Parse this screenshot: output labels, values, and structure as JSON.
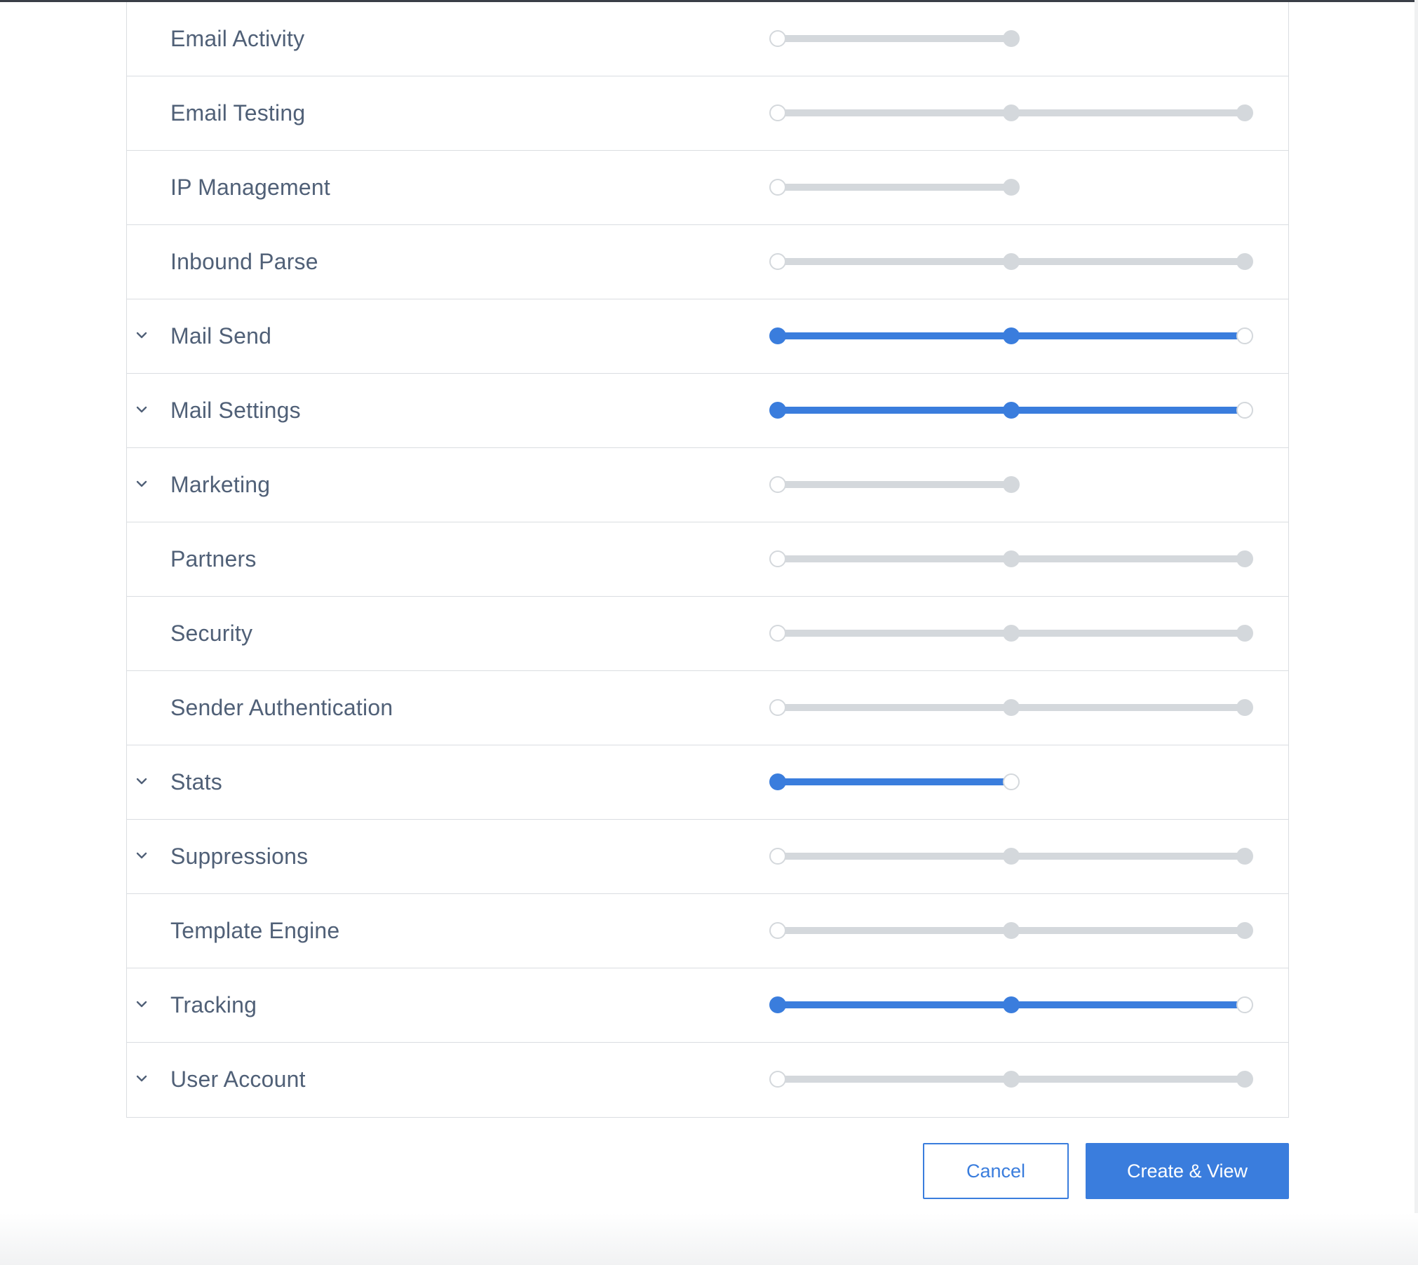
{
  "scopes": [
    {
      "label": "Email Activity",
      "expandable": false,
      "levels": 2,
      "selected": 0
    },
    {
      "label": "Email Testing",
      "expandable": false,
      "levels": 3,
      "selected": 0
    },
    {
      "label": "IP Management",
      "expandable": false,
      "levels": 2,
      "selected": 0
    },
    {
      "label": "Inbound Parse",
      "expandable": false,
      "levels": 3,
      "selected": 0
    },
    {
      "label": "Mail Send",
      "expandable": true,
      "levels": 3,
      "selected": 2
    },
    {
      "label": "Mail Settings",
      "expandable": true,
      "levels": 3,
      "selected": 2
    },
    {
      "label": "Marketing",
      "expandable": true,
      "levels": 2,
      "selected": 0
    },
    {
      "label": "Partners",
      "expandable": false,
      "levels": 3,
      "selected": 0
    },
    {
      "label": "Security",
      "expandable": false,
      "levels": 3,
      "selected": 0
    },
    {
      "label": "Sender Authentication",
      "expandable": false,
      "levels": 3,
      "selected": 0
    },
    {
      "label": "Stats",
      "expandable": true,
      "levels": 2,
      "selected": 1
    },
    {
      "label": "Suppressions",
      "expandable": true,
      "levels": 3,
      "selected": 0
    },
    {
      "label": "Template Engine",
      "expandable": false,
      "levels": 3,
      "selected": 0
    },
    {
      "label": "Tracking",
      "expandable": true,
      "levels": 3,
      "selected": 2
    },
    {
      "label": "User Account",
      "expandable": true,
      "levels": 3,
      "selected": 0
    }
  ],
  "actions": {
    "cancel_label": "Cancel",
    "create_label": "Create & View"
  },
  "colors": {
    "accent": "#3a7ddd",
    "track": "#d4d8dc",
    "label": "#506077"
  },
  "icons": {
    "expand": "chevron-down-icon"
  }
}
